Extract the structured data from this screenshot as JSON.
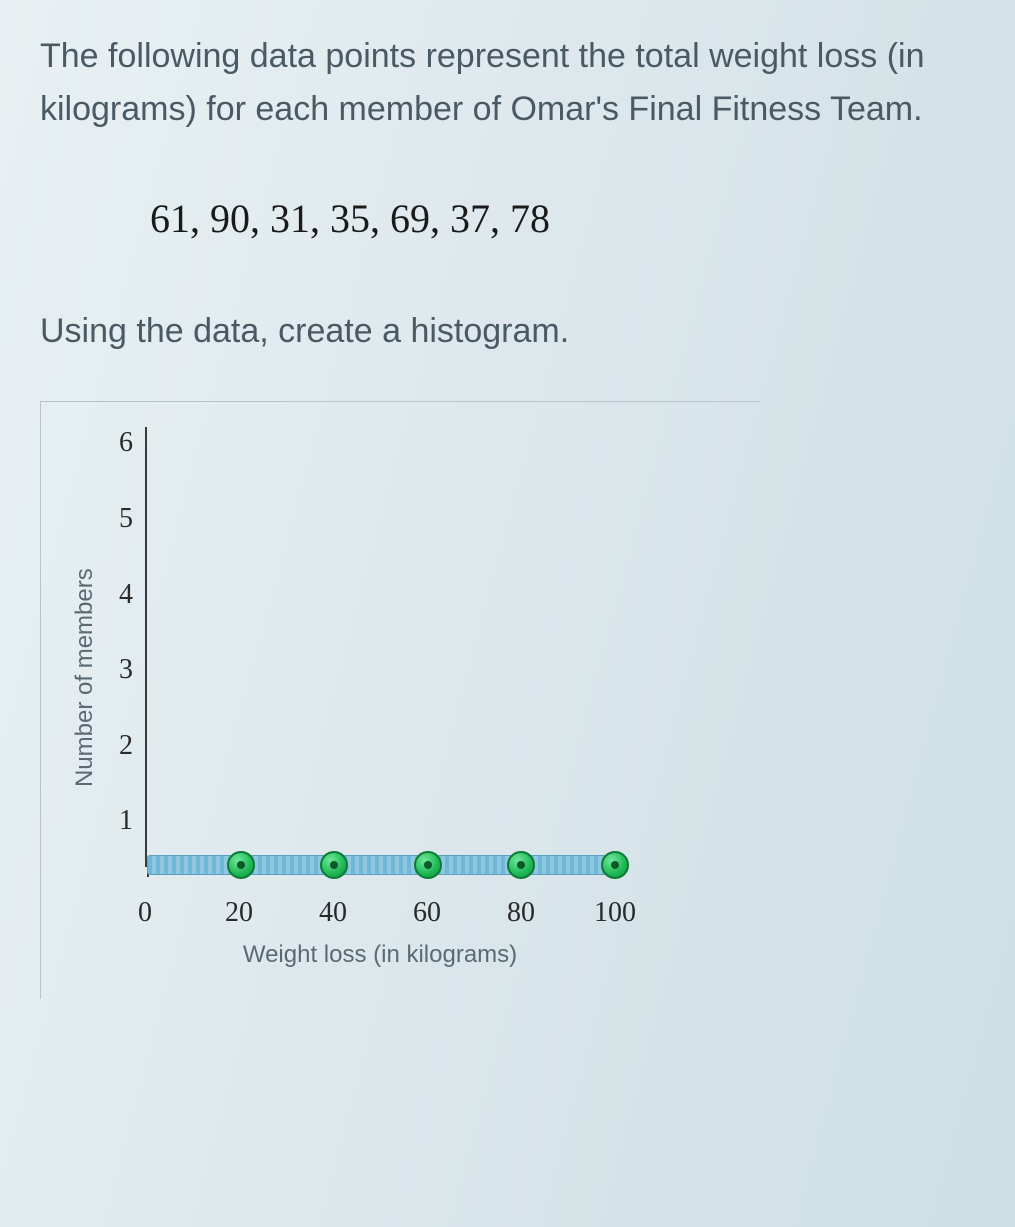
{
  "problem_text": "The following data points represent the total weight loss (in kilograms) for each member of Omar's Final Fitness Team.",
  "data_points_str": "61, 90, 31, 35, 69, 37, 78",
  "instruction": "Using the data, create a histogram.",
  "chart_data": {
    "type": "bar",
    "title": "",
    "xlabel": "Weight loss (in kilograms)",
    "ylabel": "Number of members",
    "xlim": [
      0,
      100
    ],
    "ylim": [
      0,
      6
    ],
    "x_ticks": [
      0,
      20,
      40,
      60,
      80,
      100
    ],
    "y_ticks": [
      1,
      2,
      3,
      4,
      5,
      6
    ],
    "bin_edges": [
      0,
      20,
      40,
      60,
      80,
      100
    ],
    "categories": [
      "0-20",
      "20-40",
      "40-60",
      "60-80",
      "80-100"
    ],
    "values": [
      0,
      0,
      0,
      0,
      0
    ],
    "raw_data": [
      61,
      90,
      31,
      35,
      69,
      37,
      78
    ]
  }
}
